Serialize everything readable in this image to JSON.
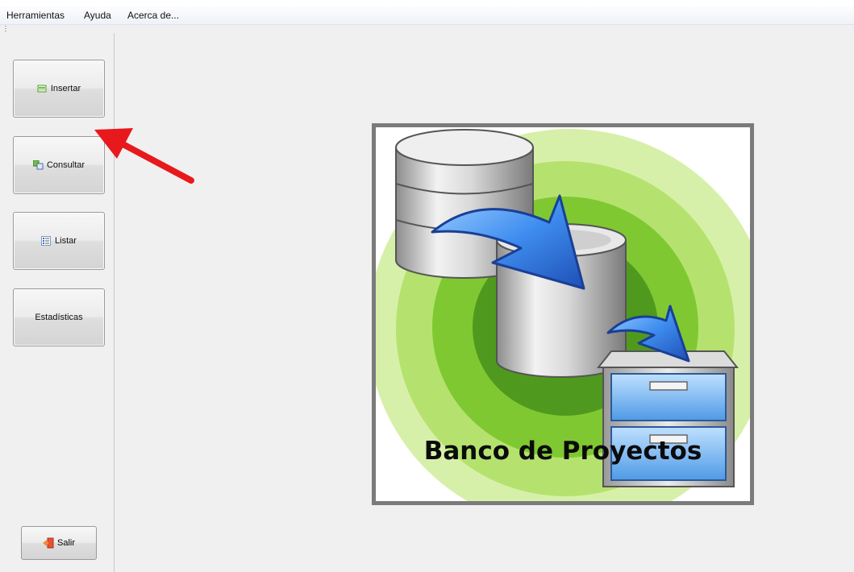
{
  "menu": [
    "Herramientas",
    "Ayuda",
    "Acerca de..."
  ],
  "sidebar": {
    "buttons": [
      {
        "label": "Insertar",
        "icon": "insert-record-icon"
      },
      {
        "label": "Consultar",
        "icon": "query-icon"
      },
      {
        "label": "Listar",
        "icon": "list-icon"
      },
      {
        "label": "Estadísticas",
        "icon": ""
      }
    ],
    "exit": {
      "label": "Salir",
      "icon": "exit-door-icon"
    }
  },
  "logo": {
    "caption": "Banco de Proyectos"
  },
  "colors": {
    "annotation_arrow": "#e8191c",
    "logo_green": "#8fd14a",
    "frame": "#7b7b7b",
    "arrow_blue": "#2f6fd8"
  }
}
